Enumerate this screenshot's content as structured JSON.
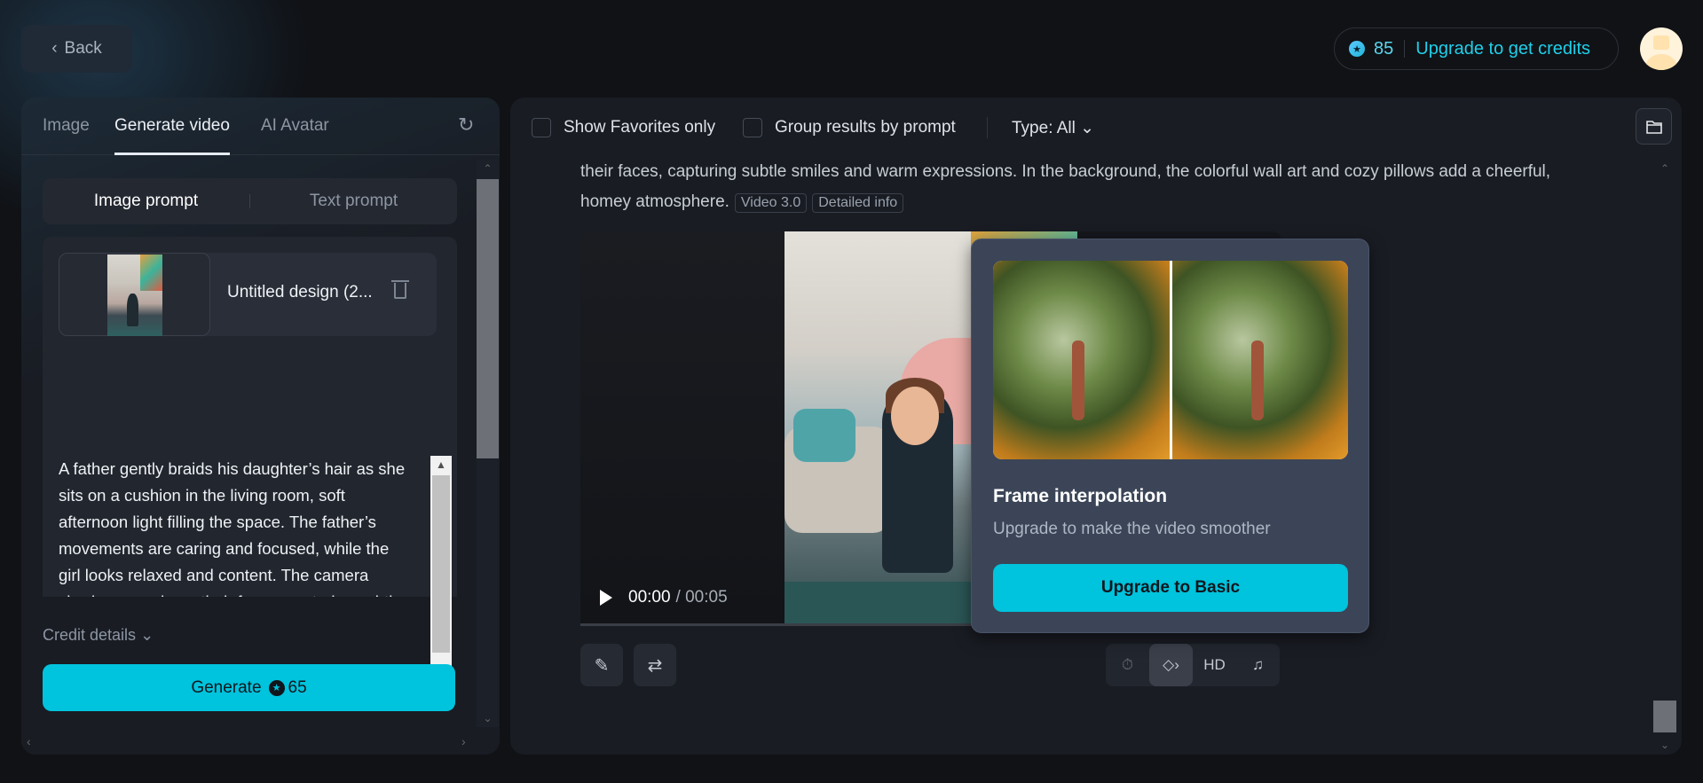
{
  "header": {
    "back_label": "Back",
    "credits": "85",
    "upgrade_label": "Upgrade to get credits"
  },
  "left_panel": {
    "tabs": [
      "Image",
      "Generate video",
      "AI Avatar"
    ],
    "active_tab": "Generate video",
    "prompt_modes": [
      "Image prompt",
      "Text prompt"
    ],
    "image_name": "Untitled design (2...",
    "prompt_text": "A father gently braids his daughter’s hair as she sits on a cushion in the living room, soft afternoon light filling the space. The father’s movements are caring and focused, while the girl looks relaxed and content. The camera slowly zooms in on their faces, capturing subtle smiles and warm expressions. In the background, the colorful wall art and cozy pillows add a cheerful,",
    "credit_details_label": "Credit details",
    "generate_label": "Generate",
    "generate_cost": "65"
  },
  "results": {
    "show_favorites_label": "Show Favorites only",
    "group_by_prompt_label": "Group results by prompt",
    "type_filter": "Type: All",
    "prompt_line1": "their faces, capturing subtle smiles and warm expressions. In the background, the colorful wall art and cozy pillows add a cheerful,",
    "prompt_line2": "homey atmosphere.",
    "model_tag": "Video 3.0",
    "detail_tag": "Detailed info",
    "video_time": "00:00",
    "video_duration": "/ 00:05",
    "hd_label": "HD"
  },
  "popup": {
    "title": "Frame interpolation",
    "subtitle": "Upgrade to make the video smoother",
    "button_label": "Upgrade to Basic"
  },
  "colors": {
    "accent": "#00c3dd",
    "background": "#101216",
    "panel": "#191c23",
    "popup": "#3b4557"
  }
}
